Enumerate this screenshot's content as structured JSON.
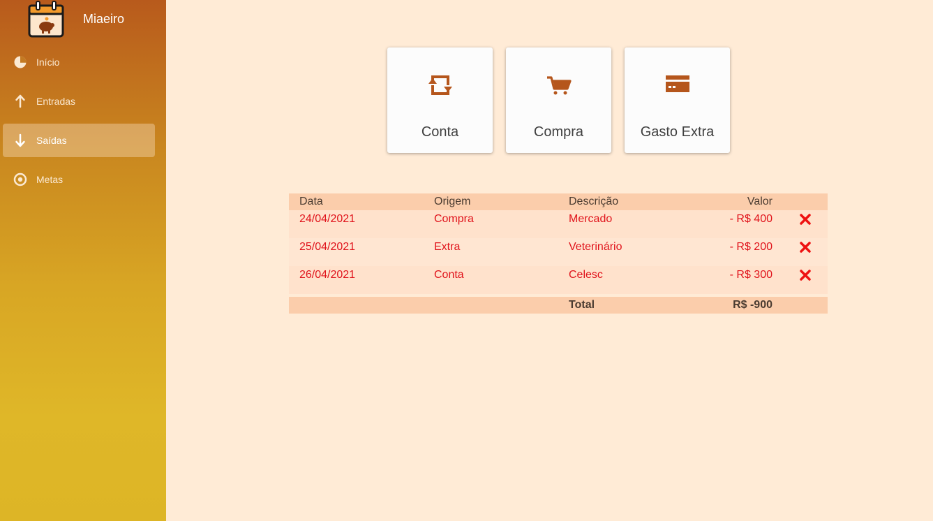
{
  "app": {
    "name": "Miaeiro"
  },
  "sidebar": {
    "items": [
      {
        "label": "Início",
        "icon": "pie-chart-icon",
        "active": false
      },
      {
        "label": "Entradas",
        "icon": "arrow-up-icon",
        "active": false
      },
      {
        "label": "Saídas",
        "icon": "arrow-down-icon",
        "active": true
      },
      {
        "label": "Metas",
        "icon": "target-icon",
        "active": false
      }
    ]
  },
  "actions": [
    {
      "label": "Conta",
      "icon": "recurring-icon"
    },
    {
      "label": "Compra",
      "icon": "cart-icon"
    },
    {
      "label": "Gasto Extra",
      "icon": "credit-card-icon"
    }
  ],
  "table": {
    "headers": {
      "date": "Data",
      "origin": "Origem",
      "description": "Descrição",
      "value": "Valor"
    },
    "rows": [
      {
        "date": "24/04/2021",
        "origin": "Compra",
        "description": "Mercado",
        "value": "- R$ 400"
      },
      {
        "date": "25/04/2021",
        "origin": "Extra",
        "description": "Veterinário",
        "value": "- R$ 200"
      },
      {
        "date": "26/04/2021",
        "origin": "Conta",
        "description": "Celesc",
        "value": "- R$ 300"
      }
    ],
    "total": {
      "label": "Total",
      "value": "R$ -900"
    }
  },
  "colors": {
    "accent": "#b5561c",
    "background": "#ffebd6",
    "negative": "#e0131b",
    "delete": "#ee1111"
  }
}
